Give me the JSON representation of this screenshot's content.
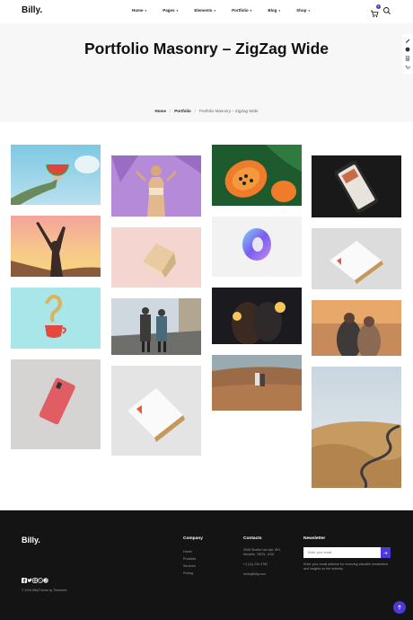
{
  "header": {
    "logo": "Billy.",
    "nav": [
      {
        "label": "Home"
      },
      {
        "label": "Pages"
      },
      {
        "label": "Elements"
      },
      {
        "label": "Portfolio"
      },
      {
        "label": "Blog"
      },
      {
        "label": "Shop"
      }
    ],
    "cart_count": "0",
    "icons": [
      "cart-icon",
      "search-icon"
    ]
  },
  "hero": {
    "title": "Portfolio Masonry – ZigZag Wide",
    "breadcrumb": {
      "home": "Home",
      "section": "Portfolio",
      "current": "Portfolio Masonry – ZigZag Wide"
    }
  },
  "side_tools": [
    "pen-icon",
    "palette-icon",
    "document-icon",
    "cart-icon"
  ],
  "gallery": {
    "columns": [
      [
        "watermelon-hand",
        "celebration-silhouette",
        "floating-cup",
        "pink-phone"
      ],
      [
        "purple-woman",
        "pink-box",
        "couple-walking",
        "business-cards"
      ],
      [
        "papaya",
        "glass-donut",
        "sparklers-couple",
        "field-couple"
      ],
      [
        "phone-dark",
        "cards-gray",
        "couple-sunset",
        "winding-road"
      ]
    ]
  },
  "footer": {
    "logo": "Billy.",
    "copyright": "© 2024 BillyTheme by Themerex",
    "social_icons": [
      "facebook-icon",
      "twitter-icon",
      "instagram-icon",
      "dribbble-icon",
      "pinterest-icon"
    ],
    "company": {
      "heading": "Company",
      "links": [
        "Home",
        "Products",
        "Services",
        "Pricing"
      ]
    },
    "contacts": {
      "heading": "Contacts",
      "address_1": "2628 Shelter Isle Apt. 891,",
      "address_2": "Neuville, 78221, USA",
      "phone": "+1 (11) 234 4782",
      "email": "hello@billy.com"
    },
    "newsletter": {
      "heading": "Newsletter",
      "placeholder": "Enter your email",
      "note_1": "Enter your email address for receiving valuable newsletters",
      "note_2": "and insights on the industry."
    }
  },
  "accent_color": "#4b3ad6"
}
